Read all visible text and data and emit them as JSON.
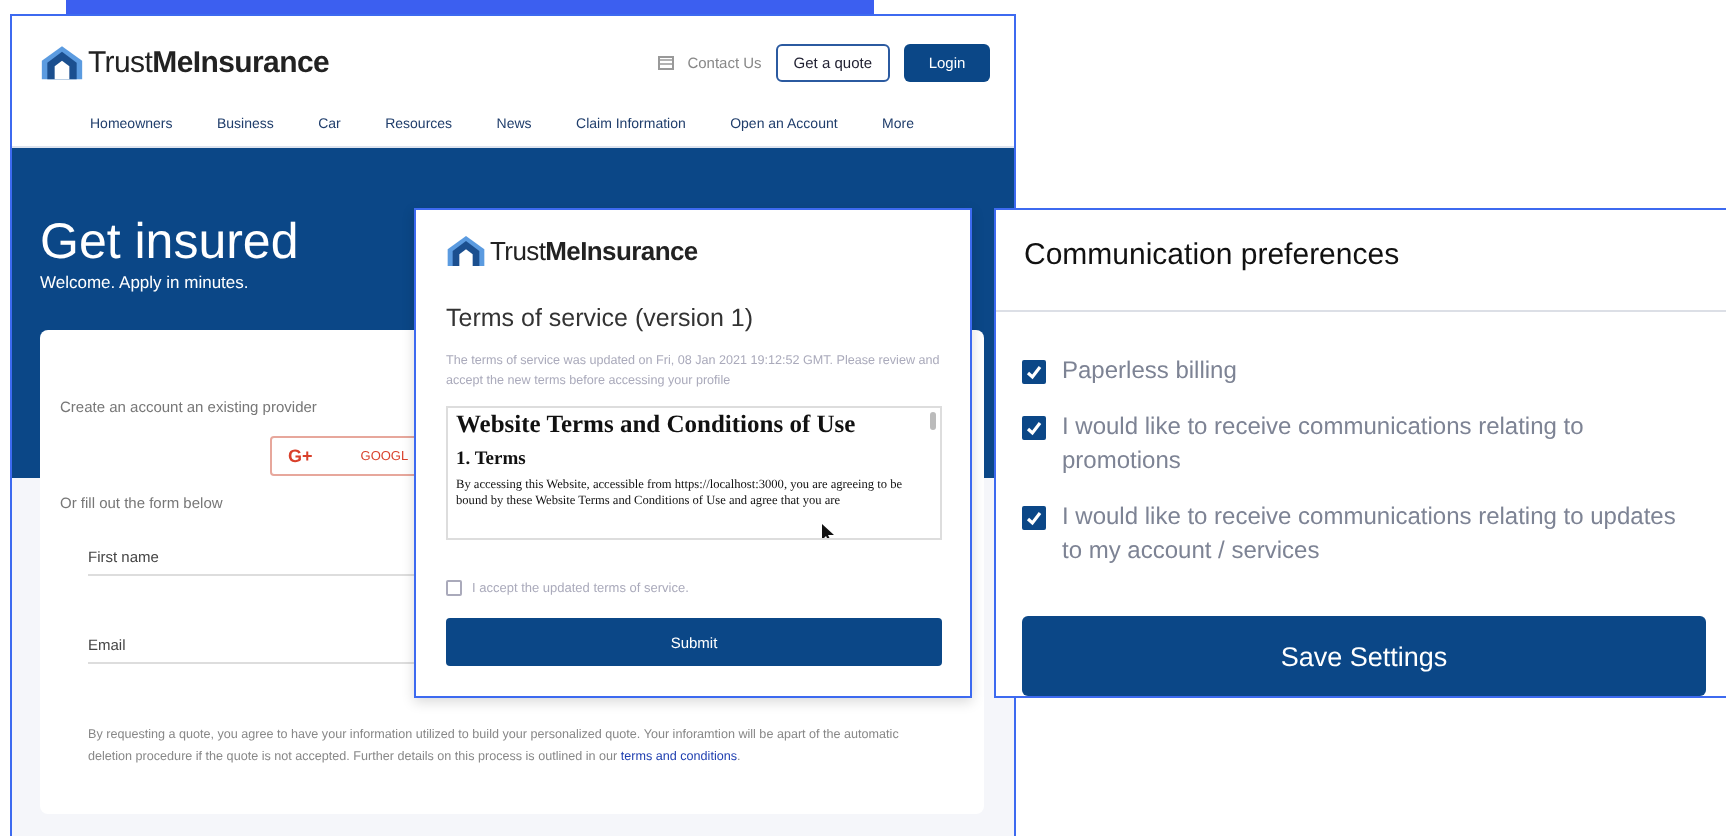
{
  "main_window": {
    "logo": "Trust**MeInsurance**",
    "contact": "Contact Us",
    "quote_button": "Get a quote",
    "login_button": "Login",
    "nav": [
      "Homeowners",
      "Business",
      "Car",
      "Resources",
      "News",
      "Claim Information",
      "Open an Account",
      "More"
    ],
    "hero": {
      "title": "Get insured",
      "subtitle": "Welcome. Apply in minutes."
    },
    "form": {
      "provider_prompt": "Create an account an existing provider",
      "google_button": {
        "icon": "G+",
        "label": "GOOGL"
      },
      "alt_prompt": "Or fill out the form below",
      "fields": [
        {
          "placeholder": "First name"
        },
        {
          "placeholder": "Email"
        }
      ],
      "notice": "By requesting a quote, you agree to have your information utilized to build your personalized quote. Your inforamtion will be apart of the automatic deletion procedure if the quote is not accepted. Further details on this process is outlined in our",
      "notice_link": "terms and conditions",
      "notice_end": "."
    }
  },
  "terms_dialog": {
    "logo": "Trust**MeInsurance**",
    "title": "Terms of service (version 1)",
    "notice": "The terms of service was updated on Fri, 08 Jan 2021 19:12:52 GMT. Please review and accept the new terms before accessing your profile",
    "document": {
      "heading": "Website Terms and Conditions of Use",
      "section": "1. Terms",
      "body": "By accessing this Website, accessible from https://localhost:3000, you are agreeing to be bound by these Website Terms and Conditions of Use and agree that you are"
    },
    "accept": {
      "label": "I accept the updated terms of service.",
      "checked": false
    },
    "submit": "Submit"
  },
  "preferences": {
    "title": "Communication preferences",
    "options": [
      {
        "label": "Paperless billing",
        "checked": true
      },
      {
        "label": "I would like to receive communications relating to promotions",
        "checked": true
      },
      {
        "label": "I would like to receive communications relating to updates to my account / services",
        "checked": true
      }
    ],
    "save": "Save Settings"
  }
}
